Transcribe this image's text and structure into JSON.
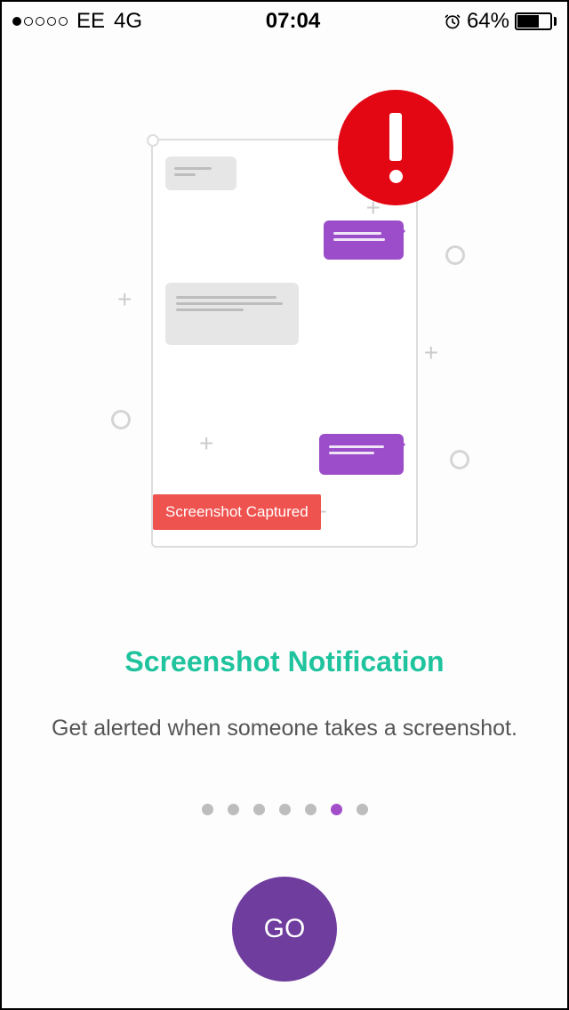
{
  "statusBar": {
    "carrier": "EE",
    "network": "4G",
    "time": "07:04",
    "batteryPercent": "64%"
  },
  "illustration": {
    "bannerText": "Screenshot Captured"
  },
  "title": "Screenshot Notification",
  "subtitle": "Get alerted when someone takes a screenshot.",
  "pager": {
    "count": 7,
    "activeIndex": 5
  },
  "cta": "GO"
}
